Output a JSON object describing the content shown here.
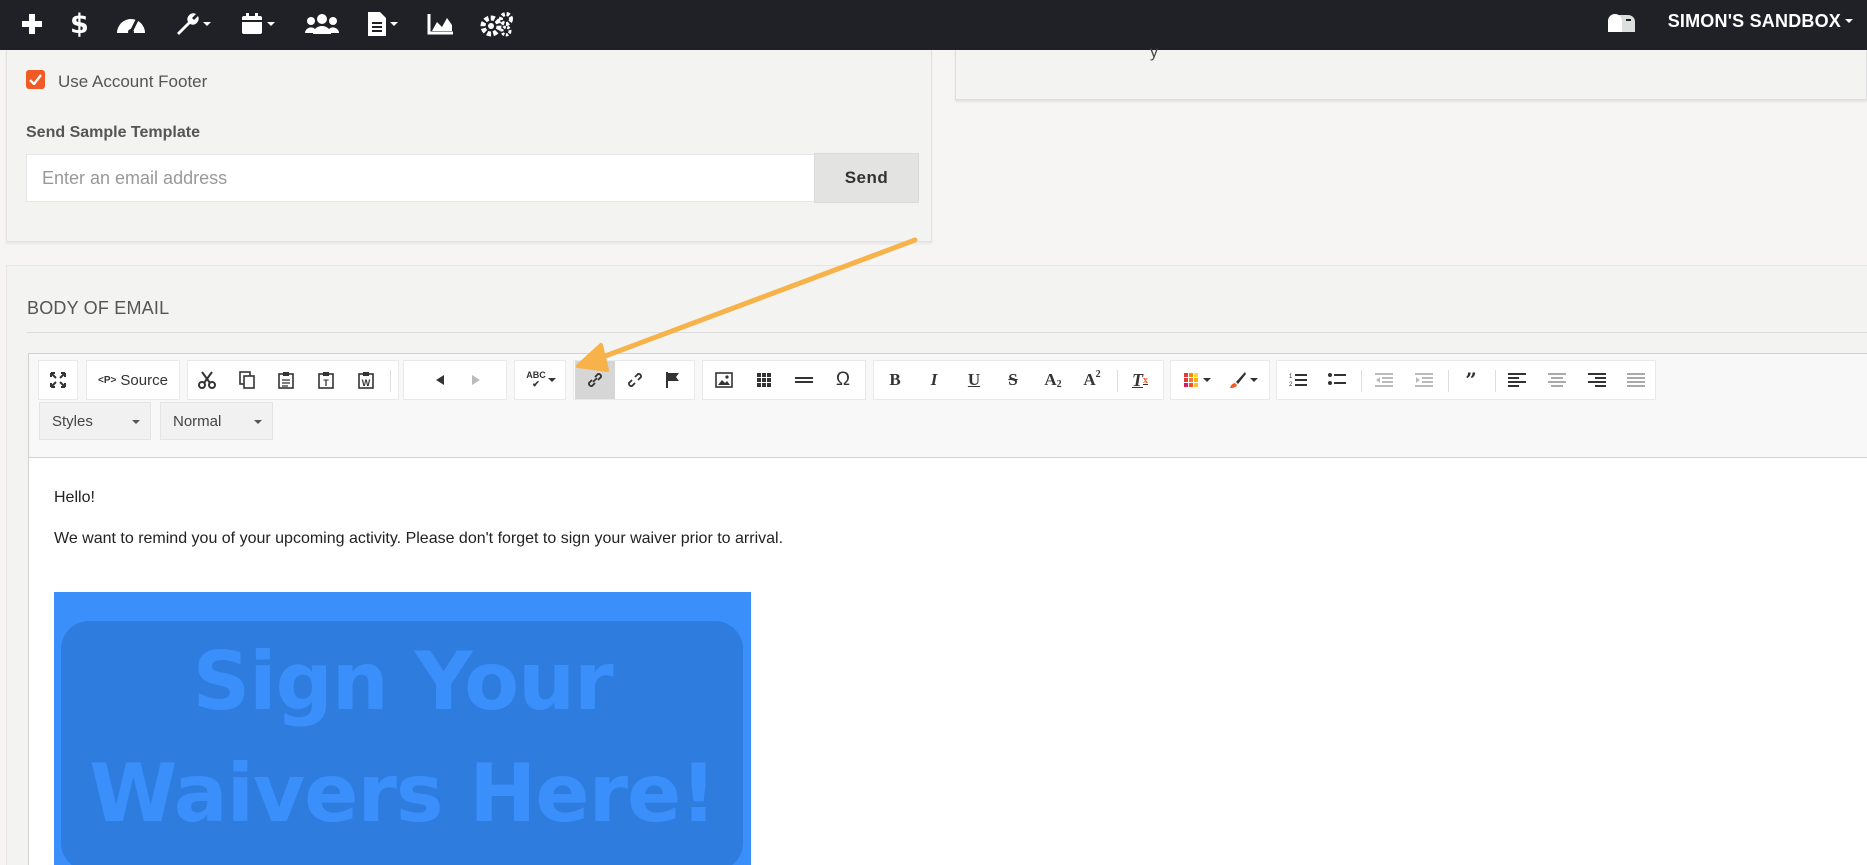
{
  "topbar": {
    "icons": [
      "plus-icon",
      "dollar-icon",
      "dashboard-icon",
      "wrench-icon",
      "calendar-icon",
      "users-icon",
      "document-icon",
      "chart-icon",
      "settings-icon"
    ],
    "account_name": "SIMON'S SANDBOX",
    "mailbox_icon": "mailbox-icon"
  },
  "panel_left": {
    "use_account_footer_label": "Use Account Footer",
    "use_account_footer_checked": true,
    "send_sample_label": "Send Sample Template",
    "email_placeholder": "Enter an email address",
    "email_value": "",
    "send_label": "Send"
  },
  "panel_right": {
    "cut_text": "y"
  },
  "body_section": {
    "title": "BODY OF EMAIL",
    "toolbar": {
      "source_label": "Source",
      "styles_label": "Styles",
      "format_label": "Normal",
      "spellcheck_label": "ABC"
    },
    "content": {
      "greeting": "Hello!",
      "message": "We want to remind you of your upcoming activity. Please don't forget to sign your waiver prior to arrival.",
      "banner_line1": "Sign Your",
      "banner_line2": "Waivers Here!"
    }
  },
  "colors": {
    "navbar": "#1f2127",
    "accent_orange": "#f15a24",
    "annotation_arrow": "#f7b24a",
    "banner_blue": "#3a8ffb",
    "banner_inner_blue": "#2f7cdf"
  }
}
